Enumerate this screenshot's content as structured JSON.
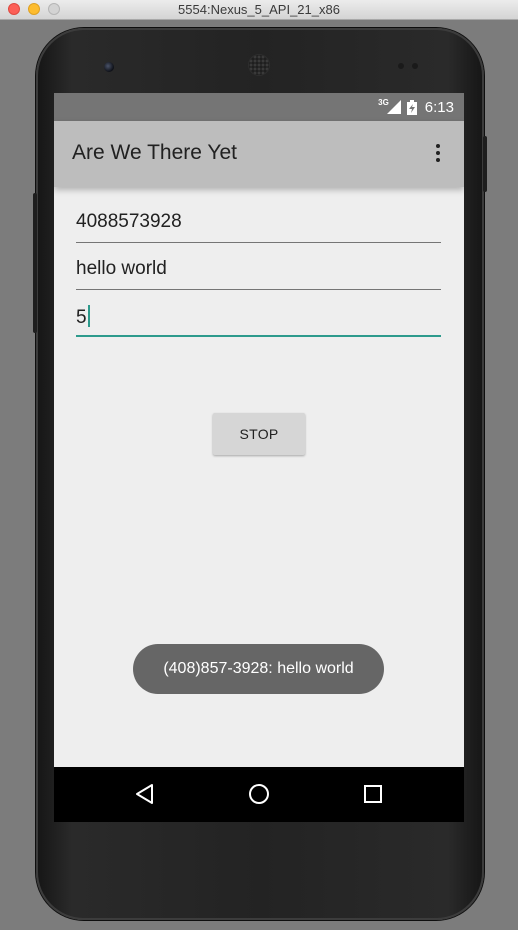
{
  "window": {
    "title": "5554:Nexus_5_API_21_x86"
  },
  "status_bar": {
    "network": "3G",
    "time": "6:13"
  },
  "app_bar": {
    "title": "Are We There Yet",
    "overflow_icon": "more-vert-icon"
  },
  "form": {
    "phone_number": "4088573928",
    "message": "hello world",
    "interval": "5"
  },
  "stop_button": {
    "label": "STOP"
  },
  "toast": {
    "text": "(408)857-3928: hello world"
  },
  "nav_bar": {
    "icons": [
      "back-icon",
      "home-icon",
      "recents-icon"
    ]
  },
  "colors": {
    "accent": "#2d9a8c",
    "app_bar": "#bdbdbd",
    "status_bar": "#757575",
    "toast": "#666666"
  }
}
